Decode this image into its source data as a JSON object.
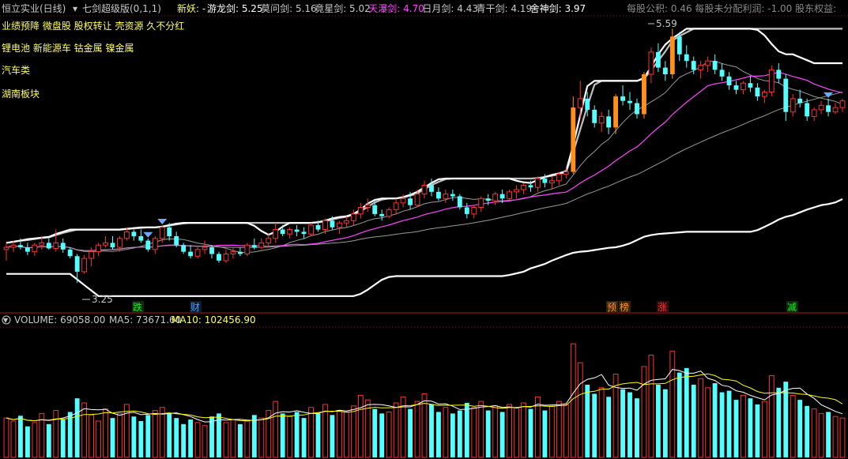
{
  "header": {
    "stock_name": "恒立实业(日线)",
    "indicator_name": "七剑超级版(0,1,1)",
    "new_demon_label": "新妖: -",
    "indicator_values": [
      {
        "label": "游龙剑: 5.25",
        "color": "#ffffff"
      },
      {
        "label": "莫问剑: 5.16",
        "color": "#c8c8c8"
      },
      {
        "label": "竟星剑: 5.02",
        "color": "#c8c8c8"
      },
      {
        "label": "天瀑剑: 4.70",
        "color": "#ff44ff"
      },
      {
        "label": "日月剑: 4.43",
        "color": "#c8c8c8"
      },
      {
        "label": "青干剑: 4.19",
        "color": "#c8c8c8"
      },
      {
        "label": "舍神剑: 3.97",
        "color": "#ffffff"
      }
    ],
    "right_info": "每股公积: 0.46  每股未分配利润: -1.00  股东权益:"
  },
  "concept_tags": [
    "业绩预降 微盘股 股权转让 壳资源 久不分红",
    "锂电池 新能源车 钴金属 镍金属",
    "汽车类",
    "湖南板块"
  ],
  "price_annotations": {
    "high": "5.59",
    "low": "3.25"
  },
  "event_markers": [
    {
      "label": "跌",
      "color": "#00ff00"
    },
    {
      "label": "财",
      "color": "#4aa0ff"
    },
    {
      "label": "预",
      "color": "#ff9020"
    },
    {
      "label": "榜",
      "color": "#ff9020"
    },
    {
      "label": "涨",
      "color": "#ff3030"
    },
    {
      "label": "减",
      "color": "#00ff00"
    }
  ],
  "volume_header": {
    "volume": "VOLUME: 69058.00",
    "ma5": "MA5: 73671.60",
    "ma10": "MA10: 102456.90"
  },
  "colors": {
    "up": "#ff3030",
    "down": "#54ffff",
    "surge": "#ff9020",
    "ma_white": "#ffffff",
    "ma_magenta": "#ff44ff",
    "ma_gray": "#9a9a9a",
    "vol_ma5": "#ffffff",
    "vol_ma10": "#ffff00",
    "signal": "#6fa8ff"
  },
  "chart_data": {
    "type": "candlestick",
    "price_ylim": [
      3.2,
      5.65
    ],
    "volume_ylim": [
      0,
      170000
    ],
    "candles": [
      [
        3.6,
        3.66,
        3.5,
        3.62
      ],
      [
        3.62,
        3.68,
        3.58,
        3.64
      ],
      [
        3.64,
        3.7,
        3.6,
        3.62
      ],
      [
        3.62,
        3.66,
        3.55,
        3.58
      ],
      [
        3.58,
        3.66,
        3.54,
        3.64
      ],
      [
        3.64,
        3.72,
        3.6,
        3.66
      ],
      [
        3.66,
        3.7,
        3.6,
        3.61
      ],
      [
        3.61,
        3.78,
        3.58,
        3.66
      ],
      [
        3.66,
        3.7,
        3.57,
        3.6
      ],
      [
        3.6,
        3.62,
        3.52,
        3.54
      ],
      [
        3.54,
        3.56,
        3.3,
        3.4
      ],
      [
        3.4,
        3.55,
        3.38,
        3.52
      ],
      [
        3.52,
        3.62,
        3.45,
        3.58
      ],
      [
        3.58,
        3.66,
        3.54,
        3.64
      ],
      [
        3.64,
        3.72,
        3.62,
        3.66
      ],
      [
        3.66,
        3.72,
        3.6,
        3.62
      ],
      [
        3.62,
        3.72,
        3.58,
        3.7
      ],
      [
        3.7,
        3.8,
        3.68,
        3.76
      ],
      [
        3.76,
        3.78,
        3.68,
        3.72
      ],
      [
        3.72,
        3.78,
        3.66,
        3.68
      ],
      [
        3.68,
        3.7,
        3.58,
        3.6
      ],
      [
        3.6,
        3.72,
        3.56,
        3.7
      ],
      [
        3.7,
        3.82,
        3.66,
        3.8
      ],
      [
        3.8,
        3.84,
        3.68,
        3.72
      ],
      [
        3.72,
        3.76,
        3.62,
        3.64
      ],
      [
        3.64,
        3.66,
        3.56,
        3.58
      ],
      [
        3.58,
        3.64,
        3.52,
        3.54
      ],
      [
        3.54,
        3.62,
        3.52,
        3.6
      ],
      [
        3.6,
        3.68,
        3.56,
        3.62
      ],
      [
        3.62,
        3.64,
        3.52,
        3.56
      ],
      [
        3.56,
        3.58,
        3.48,
        3.5
      ],
      [
        3.5,
        3.6,
        3.48,
        3.56
      ],
      [
        3.56,
        3.62,
        3.52,
        3.58
      ],
      [
        3.58,
        3.62,
        3.54,
        3.56
      ],
      [
        3.56,
        3.66,
        3.54,
        3.64
      ],
      [
        3.64,
        3.7,
        3.6,
        3.62
      ],
      [
        3.62,
        3.7,
        3.6,
        3.66
      ],
      [
        3.66,
        3.74,
        3.62,
        3.7
      ],
      [
        3.7,
        3.84,
        3.66,
        3.78
      ],
      [
        3.78,
        3.82,
        3.72,
        3.74
      ],
      [
        3.74,
        3.8,
        3.7,
        3.78
      ],
      [
        3.78,
        3.82,
        3.72,
        3.76
      ],
      [
        3.76,
        3.8,
        3.7,
        3.74
      ],
      [
        3.74,
        3.84,
        3.72,
        3.82
      ],
      [
        3.82,
        3.86,
        3.76,
        3.78
      ],
      [
        3.78,
        3.88,
        3.74,
        3.86
      ],
      [
        3.86,
        3.9,
        3.78,
        3.8
      ],
      [
        3.8,
        3.86,
        3.74,
        3.84
      ],
      [
        3.84,
        3.9,
        3.8,
        3.86
      ],
      [
        3.86,
        3.96,
        3.82,
        3.92
      ],
      [
        3.92,
        4.02,
        3.88,
        3.98
      ],
      [
        3.98,
        4.06,
        3.94,
        4.0
      ],
      [
        4.0,
        4.04,
        3.9,
        3.92
      ],
      [
        3.92,
        3.96,
        3.86,
        3.9
      ],
      [
        3.9,
        3.98,
        3.88,
        3.96
      ],
      [
        3.96,
        4.06,
        3.92,
        4.02
      ],
      [
        4.02,
        4.1,
        3.98,
        4.06
      ],
      [
        4.06,
        4.12,
        3.96,
        4.0
      ],
      [
        4.0,
        4.14,
        3.98,
        4.1
      ],
      [
        4.1,
        4.22,
        4.06,
        4.18
      ],
      [
        4.18,
        4.24,
        4.08,
        4.12
      ],
      [
        4.12,
        4.16,
        4.04,
        4.06
      ],
      [
        4.06,
        4.14,
        4.02,
        4.1
      ],
      [
        4.1,
        4.14,
        4.04,
        4.08
      ],
      [
        4.08,
        4.1,
        3.96,
        3.98
      ],
      [
        3.98,
        4.02,
        3.88,
        3.92
      ],
      [
        3.92,
        4.0,
        3.88,
        3.98
      ],
      [
        3.98,
        4.08,
        3.94,
        4.06
      ],
      [
        4.06,
        4.1,
        4.0,
        4.04
      ],
      [
        4.04,
        4.12,
        4.0,
        4.1
      ],
      [
        4.1,
        4.14,
        4.02,
        4.06
      ],
      [
        4.06,
        4.14,
        4.04,
        4.12
      ],
      [
        4.12,
        4.18,
        4.06,
        4.14
      ],
      [
        4.14,
        4.2,
        4.1,
        4.18
      ],
      [
        4.18,
        4.22,
        4.12,
        4.16
      ],
      [
        4.16,
        4.26,
        4.12,
        4.24
      ],
      [
        4.24,
        4.28,
        4.16,
        4.2
      ],
      [
        4.2,
        4.26,
        4.14,
        4.22
      ],
      [
        4.22,
        4.3,
        4.18,
        4.28
      ],
      [
        4.28,
        4.34,
        4.24,
        4.3
      ],
      [
        4.3,
        4.98,
        4.28,
        4.88
      ],
      [
        4.88,
        5.12,
        4.78,
        4.96
      ],
      [
        4.96,
        5.02,
        4.8,
        4.86
      ],
      [
        4.86,
        4.9,
        4.7,
        4.74
      ],
      [
        4.74,
        4.84,
        4.66,
        4.8
      ],
      [
        4.8,
        4.86,
        4.64,
        4.7
      ],
      [
        4.7,
        5.0,
        4.64,
        4.98
      ],
      [
        4.98,
        5.08,
        4.9,
        4.94
      ],
      [
        4.94,
        5.02,
        4.86,
        4.92
      ],
      [
        4.92,
        4.96,
        4.78,
        4.82
      ],
      [
        4.82,
        5.2,
        4.78,
        5.18
      ],
      [
        5.18,
        5.42,
        5.1,
        5.38
      ],
      [
        5.38,
        5.46,
        5.2,
        5.24
      ],
      [
        5.24,
        5.3,
        5.12,
        5.18
      ],
      [
        5.18,
        5.59,
        5.14,
        5.52
      ],
      [
        5.52,
        5.56,
        5.3,
        5.36
      ],
      [
        5.36,
        5.44,
        5.24,
        5.3
      ],
      [
        5.3,
        5.34,
        5.18,
        5.22
      ],
      [
        5.22,
        5.3,
        5.14,
        5.26
      ],
      [
        5.26,
        5.34,
        5.2,
        5.3
      ],
      [
        5.3,
        5.36,
        5.18,
        5.22
      ],
      [
        5.22,
        5.28,
        5.12,
        5.16
      ],
      [
        5.16,
        5.2,
        5.04,
        5.08
      ],
      [
        5.08,
        5.12,
        5.0,
        5.04
      ],
      [
        5.04,
        5.12,
        5.0,
        5.1
      ],
      [
        5.1,
        5.16,
        5.02,
        5.06
      ],
      [
        5.06,
        5.1,
        4.94,
        4.98
      ],
      [
        4.98,
        5.04,
        4.92,
        5.02
      ],
      [
        5.02,
        5.26,
        4.98,
        5.22
      ],
      [
        5.22,
        5.28,
        5.1,
        5.14
      ],
      [
        5.14,
        5.18,
        4.76,
        4.84
      ],
      [
        4.84,
        5.0,
        4.8,
        4.96
      ],
      [
        4.96,
        5.04,
        4.88,
        4.92
      ],
      [
        4.92,
        4.96,
        4.76,
        4.8
      ],
      [
        4.8,
        4.88,
        4.76,
        4.86
      ],
      [
        4.86,
        4.94,
        4.82,
        4.9
      ],
      [
        4.9,
        4.96,
        4.8,
        4.84
      ],
      [
        4.84,
        4.92,
        4.82,
        4.88
      ],
      [
        4.88,
        4.96,
        4.84,
        4.94
      ]
    ],
    "volume": [
      52000,
      48000,
      55000,
      41000,
      46000,
      58000,
      44000,
      62000,
      50000,
      60000,
      78000,
      72000,
      56000,
      48000,
      64000,
      52000,
      58000,
      70000,
      54000,
      48000,
      56000,
      62000,
      66000,
      58000,
      52000,
      44000,
      50000,
      46000,
      42000,
      54000,
      58000,
      46000,
      50000,
      44000,
      48000,
      56000,
      52000,
      62000,
      74000,
      58000,
      54000,
      60000,
      52000,
      66000,
      58000,
      70000,
      56000,
      62000,
      60000,
      68000,
      82000,
      76000,
      64000,
      58000,
      60000,
      72000,
      80000,
      64000,
      74000,
      84000,
      70000,
      60000,
      66000,
      58000,
      62000,
      72000,
      66000,
      74000,
      62000,
      68000,
      60000,
      70000,
      66000,
      72000,
      64000,
      80000,
      62000,
      68000,
      74000,
      70000,
      150000,
      125000,
      96000,
      84000,
      92000,
      80000,
      110000,
      90000,
      86000,
      78000,
      120000,
      135000,
      96000,
      90000,
      140000,
      112000,
      118000,
      96000,
      104000,
      92000,
      98000,
      86000,
      88000,
      76000,
      82000,
      78000,
      70000,
      74000,
      108000,
      92000,
      100000,
      82000,
      76000,
      68000,
      64000,
      58000,
      60000,
      54000,
      52000
    ]
  }
}
